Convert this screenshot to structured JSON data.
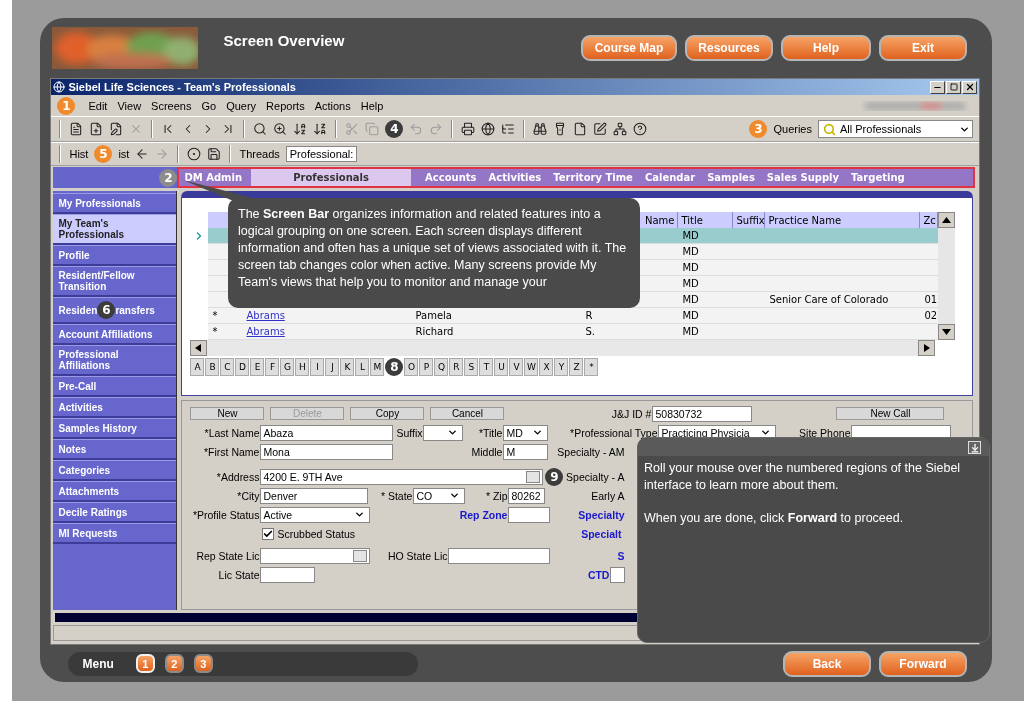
{
  "header": {
    "title": "Screen Overview",
    "buttons": [
      "Course Map",
      "Resources",
      "Help",
      "Exit"
    ]
  },
  "window": {
    "title": "Siebel Life Sciences - Team's Professionals"
  },
  "menu_bar": {
    "badge": {
      "label": "1",
      "color": "#f08a2c"
    },
    "items": [
      "Edit",
      "View",
      "Screens",
      "Go",
      "Query",
      "Reports",
      "Actions",
      "Help"
    ]
  },
  "toolbar": {
    "badge": {
      "label": "4",
      "color": "#3c3c3c"
    },
    "queries_badge": {
      "label": "3",
      "color": "#f08a2c"
    },
    "queries_label": "Queries",
    "queries_value": "All Professionals"
  },
  "history_bar": {
    "text_before": "Hist",
    "badge": {
      "label": "5",
      "color": "#f08a2c"
    },
    "text_after": "ist",
    "threads_label": "Threads",
    "threads_value": "Professional:"
  },
  "screen_bar": {
    "badge": {
      "label": "2",
      "color": "#8c8c8c"
    },
    "tabs": [
      {
        "label": "DM Admin",
        "selected": false
      },
      {
        "label": "Professionals",
        "selected": true
      },
      {
        "label": "Accounts",
        "selected": false
      },
      {
        "label": "Activities",
        "selected": false
      },
      {
        "label": "Territory Time",
        "selected": false
      },
      {
        "label": "Calendar",
        "selected": false
      },
      {
        "label": "Samples",
        "selected": false
      },
      {
        "label": "Sales Supply",
        "selected": false
      },
      {
        "label": "Targeting",
        "selected": false
      }
    ]
  },
  "sidebar": {
    "items": [
      {
        "label": "My Professionals",
        "selected": false
      },
      {
        "label": "My Team's Professionals",
        "selected": true
      },
      {
        "label": "Profile",
        "selected": false
      },
      {
        "label": "Resident/Fellow Transition",
        "selected": false
      },
      {
        "label": "Residen",
        "badge": {
          "label": "6",
          "color": "#3c3c3c"
        },
        "label_after": "ransfers",
        "selected": false
      },
      {
        "label": "Account Affiliations",
        "selected": false
      },
      {
        "label": "Professional Affiliations",
        "selected": false
      },
      {
        "label": "Pre-Call",
        "selected": false
      },
      {
        "label": "Activities",
        "selected": false
      },
      {
        "label": "Samples History",
        "selected": false
      },
      {
        "label": "Notes",
        "selected": false
      },
      {
        "label": "Categories",
        "selected": false
      },
      {
        "label": "Attachments",
        "selected": false
      },
      {
        "label": "Decile Ratings",
        "selected": false
      },
      {
        "label": "MI Requests",
        "selected": false
      }
    ]
  },
  "list": {
    "columns": [
      "Name",
      "Title",
      "Suffix",
      "Practice Name",
      "Zc"
    ],
    "rows": [
      {
        "selected": true,
        "title": "MD"
      },
      {
        "selected": false,
        "title": "MD"
      },
      {
        "selected": false,
        "title": "MD"
      },
      {
        "selected": false,
        "title": "MD"
      },
      {
        "selected": false,
        "title": "MD",
        "practice": "Senior Care of Colorado",
        "zip": "01"
      },
      {
        "selected": false,
        "marker": "*",
        "last_name": "Abrams",
        "first_name": "Pamela",
        "middle": "R",
        "title": "MD",
        "zip": "02"
      },
      {
        "selected": false,
        "marker": "*",
        "last_name": "Abrams",
        "first_name": "Richard",
        "middle": "S.",
        "title": "MD"
      }
    ],
    "alphabet_before": [
      "A",
      "B",
      "C",
      "D",
      "E",
      "F",
      "G",
      "H",
      "I",
      "J",
      "K",
      "L",
      "M"
    ],
    "badge": {
      "label": "8",
      "color": "#3c3c3c"
    },
    "alphabet_after": [
      "O",
      "P",
      "Q",
      "R",
      "S",
      "T",
      "U",
      "V",
      "W",
      "X",
      "Y",
      "Z",
      "*"
    ]
  },
  "form": {
    "buttons": [
      {
        "label": "New",
        "disabled": false
      },
      {
        "label": "Delete",
        "disabled": true
      },
      {
        "label": "Copy",
        "disabled": false
      },
      {
        "label": "Cancel",
        "disabled": false
      }
    ],
    "id_label": "J&J ID #",
    "id_value": "50830732",
    "new_call": "New Call",
    "last_name": {
      "label": "*Last Name",
      "value": "Abaza"
    },
    "suffix": {
      "label": "Suffix"
    },
    "title": {
      "label": "*Title",
      "value": "MD"
    },
    "professional_type": {
      "label": "*Professional Type",
      "value": "Practicing Physicia"
    },
    "site_phone": {
      "label": "Site Phone"
    },
    "first_name": {
      "label": "*First Name",
      "value": "Mona"
    },
    "middle": {
      "label": "Middle",
      "value": "M"
    },
    "address": {
      "label": "*Address",
      "value": "4200 E. 9TH Ave",
      "badge": {
        "label": "9",
        "color": "#3c3c3c"
      }
    },
    "city": {
      "label": "*City",
      "value": "Denver"
    },
    "state": {
      "label": "* State",
      "value": "CO"
    },
    "zip": {
      "label": "* Zip",
      "value": "80262"
    },
    "profile_status": {
      "label": "*Profile Status",
      "value": "Active"
    },
    "rep_zone": {
      "label": "Rep Zone"
    },
    "scrubbed": {
      "label": "Scrubbed Status",
      "checked": true
    },
    "rep_state_lic": {
      "label": "Rep State Lic"
    },
    "ho_state_lic": {
      "label": "HO State Lic"
    },
    "lic_state": {
      "label": "Lic State"
    },
    "ctd": {
      "label": "CTD"
    },
    "right_labels": [
      {
        "label": "Specialty - AM",
        "kind": "plain"
      },
      {
        "label": "Specialty - A",
        "kind": "plain"
      },
      {
        "label": "Early A",
        "kind": "plain"
      },
      {
        "label": "Specialty",
        "kind": "emphasis"
      },
      {
        "label": "Specialt",
        "kind": "emphasis"
      },
      {
        "label": "S",
        "kind": "emphasis"
      }
    ]
  },
  "tooltip": {
    "text": "The **Screen Bar** organizes information and related features into a logical grouping on one screen. Each screen displays different information and often has a unique set of views associated with it. The screen tab changes color when active. Many screens provide My Team's views that help you to monitor and manage your"
  },
  "info_panel": {
    "paragraphs": [
      "Roll your mouse over the numbered regions of the Siebel interface to learn more about them.",
      "When you are done, click **Forward** to proceed."
    ]
  },
  "footer": {
    "menu_label": "Menu",
    "pages": [
      {
        "label": "1",
        "selected": true
      },
      {
        "label": "2",
        "selected": false
      },
      {
        "label": "3",
        "selected": false
      }
    ],
    "buttons": [
      "Back",
      "Forward"
    ]
  }
}
